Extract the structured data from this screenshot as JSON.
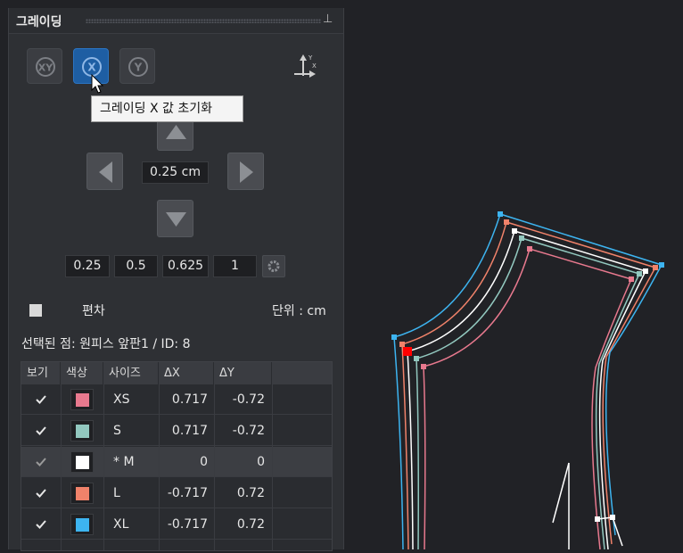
{
  "panel": {
    "title": "그레이딩",
    "pin_icon": "pin-icon",
    "tooltip": "그레이딩 X 값 초기화",
    "value": "0.25 cm",
    "presets": [
      "0.25",
      "0.5",
      "0.625",
      "1"
    ],
    "deviation_label": "편차",
    "unit_label": "단위 : cm",
    "selected_point": "선택된 점: 원피스 앞판1 / ID: 8"
  },
  "table": {
    "headers": [
      "보기",
      "색상",
      "사이즈",
      "ΔX",
      "ΔY"
    ],
    "rows": [
      {
        "size": "XS",
        "dx": "0.717",
        "dy": "-0.72",
        "color": "#e8798e",
        "checked": true
      },
      {
        "size": "S",
        "dx": "0.717",
        "dy": "-0.72",
        "color": "#92c8bf",
        "checked": true
      },
      {
        "size": "* M",
        "dx": "0",
        "dy": "0",
        "color": "#ffffff",
        "checked": true,
        "highlighted": true
      },
      {
        "size": "L",
        "dx": "-0.717",
        "dy": "0.72",
        "color": "#f0826a",
        "checked": true
      },
      {
        "size": "XL",
        "dx": "-0.717",
        "dy": "0.72",
        "color": "#3db4f0",
        "checked": true
      }
    ]
  },
  "colors": {
    "accent": "#1e5ea3",
    "selected_point": "#ff0000"
  }
}
